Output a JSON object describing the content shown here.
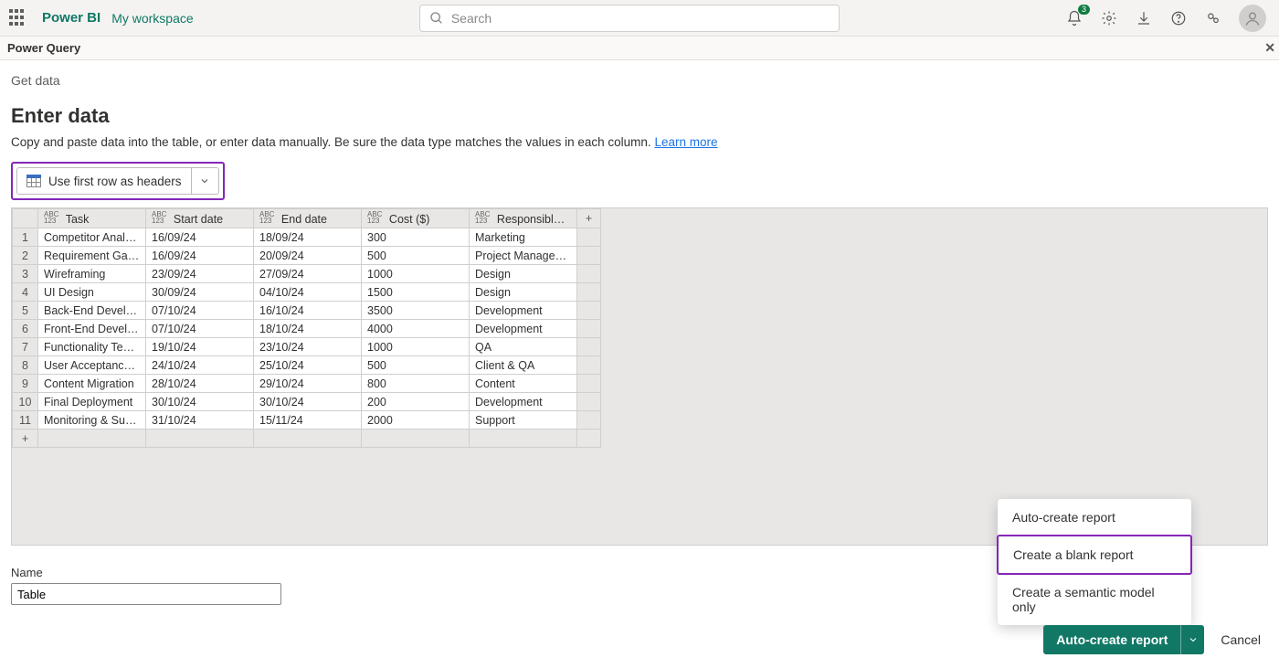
{
  "nav": {
    "brand": "Power BI",
    "workspace": "My workspace",
    "search_placeholder": "Search",
    "badge": "3"
  },
  "subheader": {
    "title": "Power Query"
  },
  "page": {
    "breadcrumb": "Get data",
    "title": "Enter data",
    "description": "Copy and paste data into the table, or enter data manually. Be sure the data type matches the values in each column. ",
    "learn_more": "Learn more",
    "headers_button": "Use first row as headers"
  },
  "columns": [
    {
      "type": "ABC 123",
      "label": "Task"
    },
    {
      "type": "ABC 123",
      "label": "Start date"
    },
    {
      "type": "ABC 123",
      "label": "End date"
    },
    {
      "type": "ABC 123",
      "label": "Cost ($)"
    },
    {
      "type": "ABC 123",
      "label": "Responsible Te..."
    }
  ],
  "rows": [
    [
      "Competitor Analysis",
      "16/09/24",
      "18/09/24",
      "300",
      "Marketing"
    ],
    [
      "Requirement Gathe...",
      "16/09/24",
      "20/09/24",
      "500",
      "Project Management"
    ],
    [
      "Wireframing",
      "23/09/24",
      "27/09/24",
      "1000",
      "Design"
    ],
    [
      "UI Design",
      "30/09/24",
      "04/10/24",
      "1500",
      "Design"
    ],
    [
      "Back-End Develop...",
      "07/10/24",
      "16/10/24",
      "3500",
      "Development"
    ],
    [
      "Front-End Develop...",
      "07/10/24",
      "18/10/24",
      "4000",
      "Development"
    ],
    [
      "Functionality Testing",
      "19/10/24",
      "23/10/24",
      "1000",
      "QA"
    ],
    [
      "User Acceptance T...",
      "24/10/24",
      "25/10/24",
      "500",
      "Client & QA"
    ],
    [
      "Content Migration",
      "28/10/24",
      "29/10/24",
      "800",
      "Content"
    ],
    [
      "Final Deployment",
      "30/10/24",
      "30/10/24",
      "200",
      "Development"
    ],
    [
      "Monitoring & Support",
      "31/10/24",
      "15/11/24",
      "2000",
      "Support"
    ]
  ],
  "name_field": {
    "label": "Name",
    "value": "Table"
  },
  "menu": {
    "items": [
      "Auto-create report",
      "Create a blank report",
      "Create a semantic model only"
    ],
    "selected": 1
  },
  "footer": {
    "primary": "Auto-create report",
    "cancel": "Cancel"
  }
}
